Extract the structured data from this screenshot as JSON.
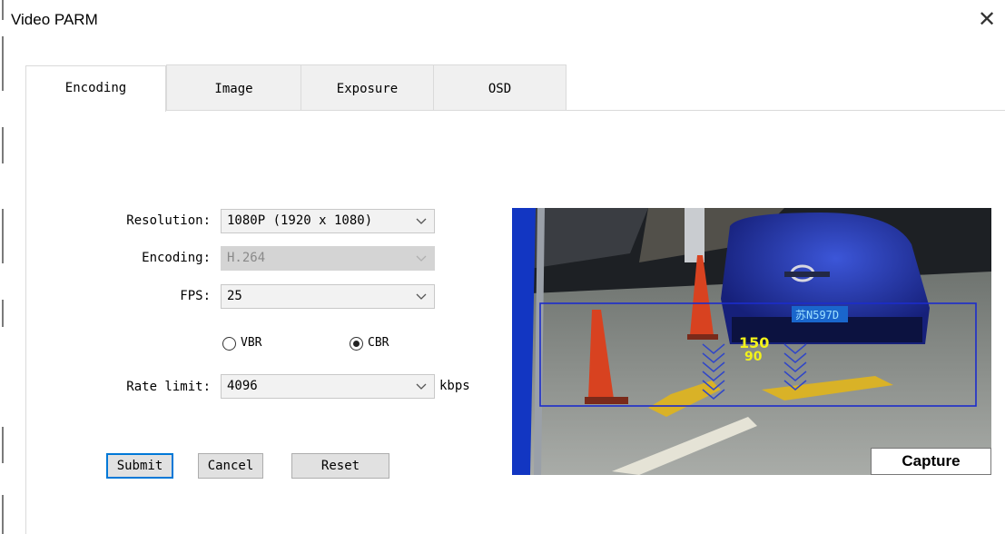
{
  "window": {
    "title": "Video PARM",
    "close_glyph": "✕"
  },
  "tabs": [
    {
      "label": "Encoding",
      "active": true
    },
    {
      "label": "Image",
      "active": false
    },
    {
      "label": "Exposure",
      "active": false
    },
    {
      "label": "OSD",
      "active": false
    }
  ],
  "form": {
    "resolution": {
      "label": "Resolution:",
      "value": "1080P (1920 x 1080)"
    },
    "encoding": {
      "label": "Encoding:",
      "value": "H.264",
      "disabled": true
    },
    "fps": {
      "label": "FPS:",
      "value": "25"
    },
    "bitrate_mode": {
      "options": [
        "VBR",
        "CBR"
      ],
      "selected": "CBR"
    },
    "rate_limit": {
      "label": "Rate limit:",
      "value": "4096",
      "unit": "kbps"
    }
  },
  "buttons": {
    "submit": "Submit",
    "cancel": "Cancel",
    "reset": "Reset"
  },
  "preview": {
    "plate_text": "苏N597D",
    "overlay_numbers": [
      "150",
      "90"
    ],
    "capture_label": "Capture",
    "detection_box_color": "#1c2ccc",
    "overlay_text_color": "#f2f21a"
  }
}
